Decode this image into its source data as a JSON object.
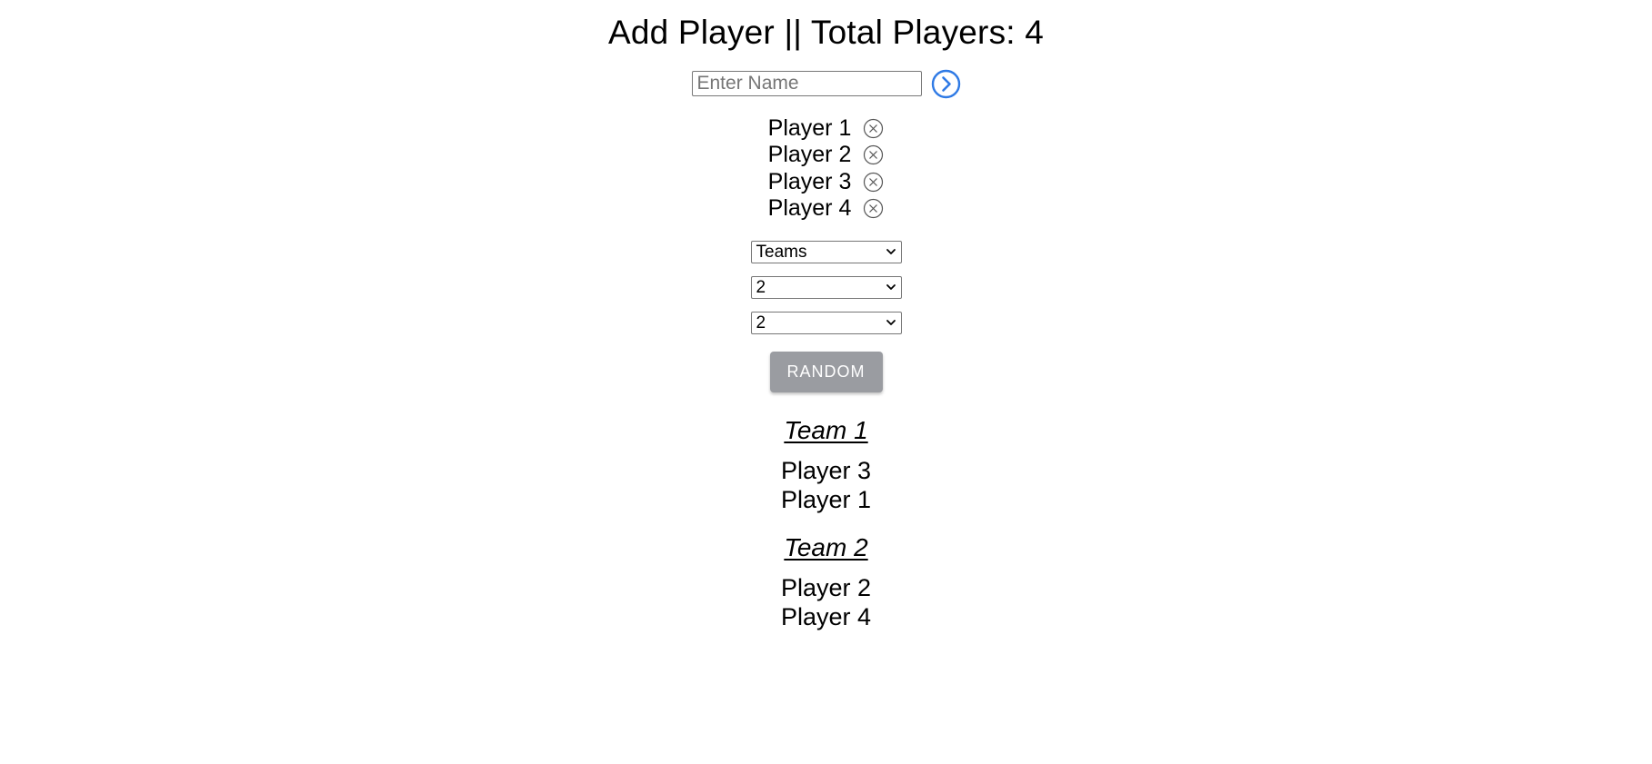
{
  "header": {
    "title": "Add Player || Total Players: 4"
  },
  "add_player": {
    "placeholder": "Enter Name",
    "value": "",
    "submit_icon": "chevron-right-circle-icon",
    "accent_color": "#2f7ae5"
  },
  "players": [
    {
      "name": "Player 1",
      "remove_icon": "circle-x-icon"
    },
    {
      "name": "Player 2",
      "remove_icon": "circle-x-icon"
    },
    {
      "name": "Player 3",
      "remove_icon": "circle-x-icon"
    },
    {
      "name": "Player 4",
      "remove_icon": "circle-x-icon"
    }
  ],
  "controls": {
    "mode_select": "Teams",
    "count_select_1": "2",
    "count_select_2": "2",
    "random_label": "RANDOM",
    "random_color": "#9a9ca1"
  },
  "teams": [
    {
      "title": "Team 1",
      "members": [
        "Player 3",
        "Player 1"
      ]
    },
    {
      "title": "Team 2",
      "members": [
        "Player 2",
        "Player 4"
      ]
    }
  ]
}
